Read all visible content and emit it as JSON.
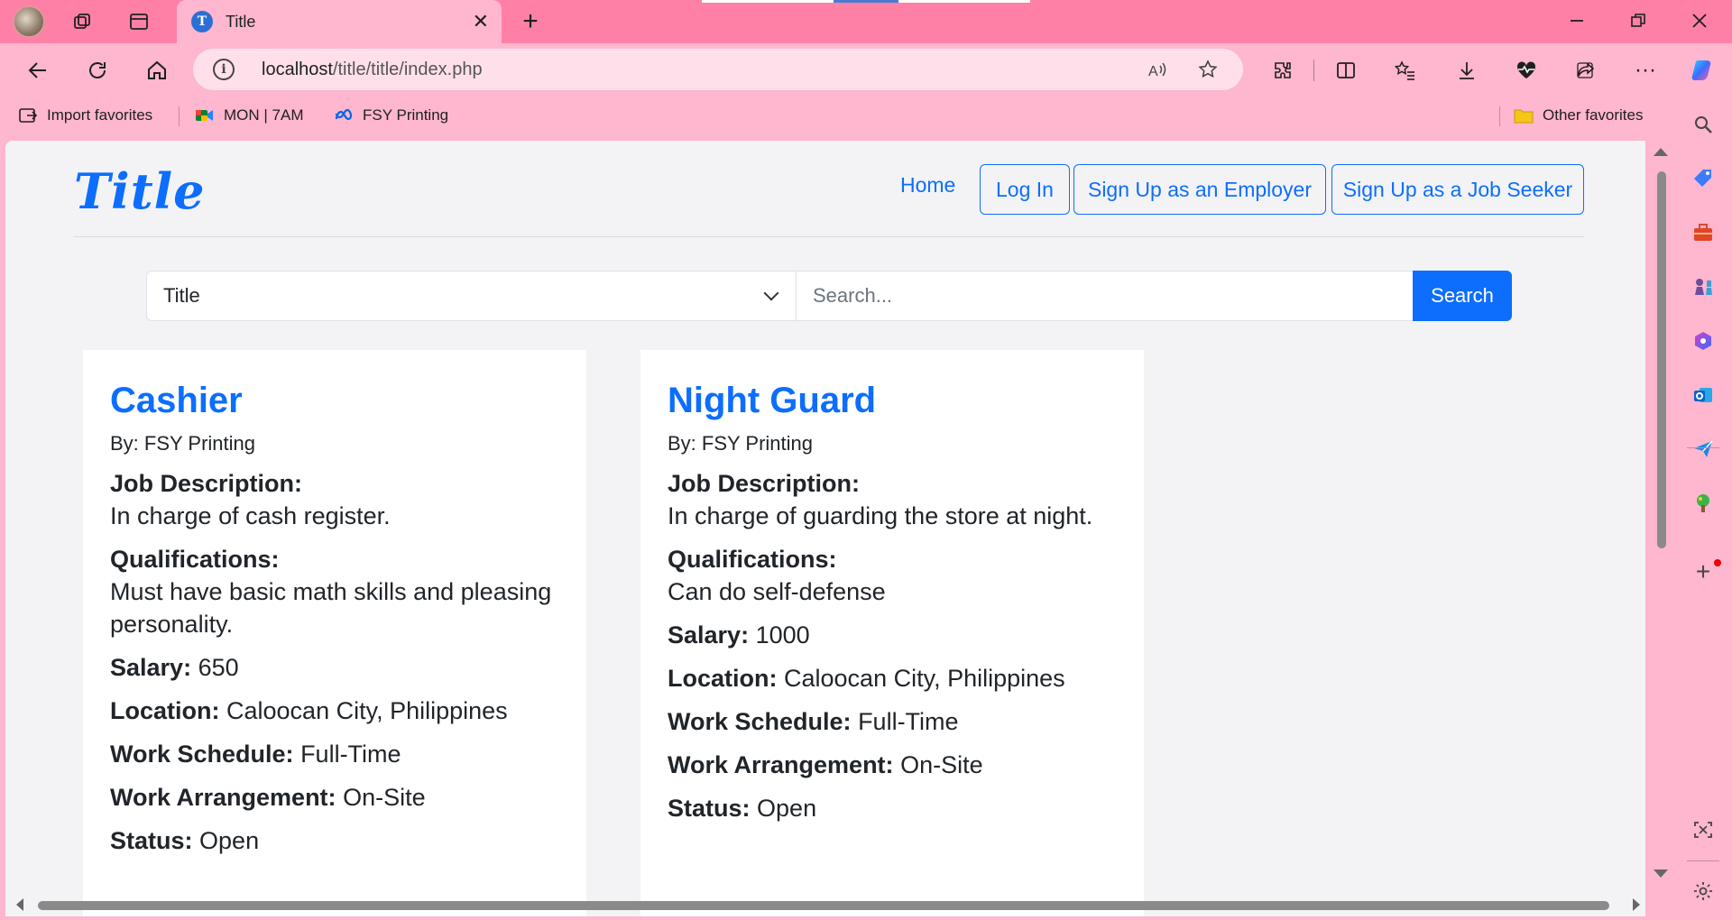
{
  "browser": {
    "tab_title": "Title",
    "tab_favicon_letter": "T",
    "url_host": "localhost",
    "url_path": "/title/title/index.php",
    "favorites": [
      {
        "label": "Import favorites"
      },
      {
        "label": "MON | 7AM"
      },
      {
        "label": "FSY Printing"
      }
    ],
    "other_favorites": "Other favorites"
  },
  "page": {
    "brand": "Title",
    "nav": {
      "home": "Home",
      "login": "Log In",
      "signup_employer": "Sign Up as an Employer",
      "signup_seeker": "Sign Up as a Job Seeker"
    },
    "search": {
      "category_selected": "Title",
      "placeholder": "Search...",
      "button": "Search"
    },
    "labels": {
      "by": "By:",
      "job_description": "Job Description:",
      "qualifications": "Qualifications:",
      "salary": "Salary:",
      "location": "Location:",
      "work_schedule": "Work Schedule:",
      "work_arrangement": "Work Arrangement:",
      "status": "Status:"
    },
    "jobs": [
      {
        "title": "Cashier",
        "company": "FSY Printing",
        "description": "In charge of cash register.",
        "qualifications": "Must have basic math skills and pleasing personality.",
        "salary": "650",
        "location": "Caloocan City, Philippines",
        "work_schedule": "Full-Time",
        "work_arrangement": "On-Site",
        "status": "Open"
      },
      {
        "title": "Night Guard",
        "company": "FSY Printing",
        "description": "In charge of guarding the store at night.",
        "qualifications": "Can do self-defense",
        "salary": "1000",
        "location": "Caloocan City, Philippines",
        "work_schedule": "Full-Time",
        "work_arrangement": "On-Site",
        "status": "Open"
      }
    ]
  },
  "colors": {
    "frame": "#ff80a6",
    "toolbar": "#ffb6cf",
    "accent": "#0d6efd",
    "page_bg": "#f3f3f5"
  }
}
